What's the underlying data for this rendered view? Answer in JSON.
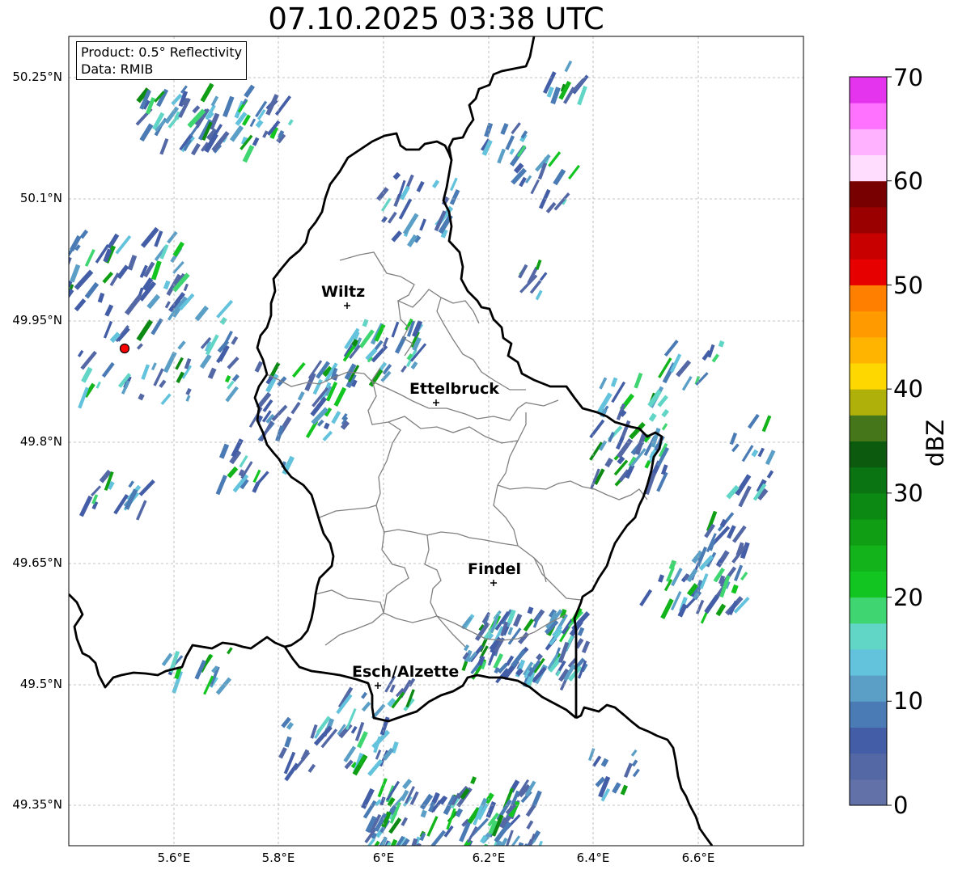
{
  "title": "07.10.2025 03:38 UTC",
  "info": {
    "product": "Product: 0.5° Reflectivity",
    "source": "Data: RMIB"
  },
  "cities": [
    {
      "name": "Wiltz"
    },
    {
      "name": "Ettelbruck"
    },
    {
      "name": "Findel"
    },
    {
      "name": "Esch/Alzette"
    }
  ],
  "axes": {
    "lat_ticks": [
      "50.25°N",
      "50.1°N",
      "49.95°N",
      "49.8°N",
      "49.65°N",
      "49.5°N",
      "49.35°N"
    ],
    "lon_ticks": [
      "5.6°E",
      "5.8°E",
      "6°E",
      "6.2°E",
      "6.4°E",
      "6.6°E"
    ]
  },
  "colorbar": {
    "label": "dBZ",
    "ticks": [
      "0",
      "10",
      "20",
      "30",
      "40",
      "50",
      "60",
      "70"
    ],
    "min": 0,
    "max": 70,
    "step": 2.5,
    "colors": [
      "#6272a8",
      "#5468a6",
      "#435ea6",
      "#4a7bb4",
      "#5b9fc7",
      "#63c2dc",
      "#61d6c6",
      "#3fd671",
      "#13c521",
      "#13b41b",
      "#109f14",
      "#0c8912",
      "#0a7412",
      "#0b5a0d",
      "#46761a",
      "#b0b00a",
      "#ffd700",
      "#ffb400",
      "#ff9a00",
      "#ff7f00",
      "#e60000",
      "#c80000",
      "#9b0000",
      "#780000",
      "#ffddff",
      "#ffb2ff",
      "#ff72ff",
      "#e534ee"
    ]
  },
  "colors": {
    "border_country": "#000000",
    "border_canton": "#808080",
    "radar_site": "#ff0000",
    "grid": "#b0b0b0"
  }
}
